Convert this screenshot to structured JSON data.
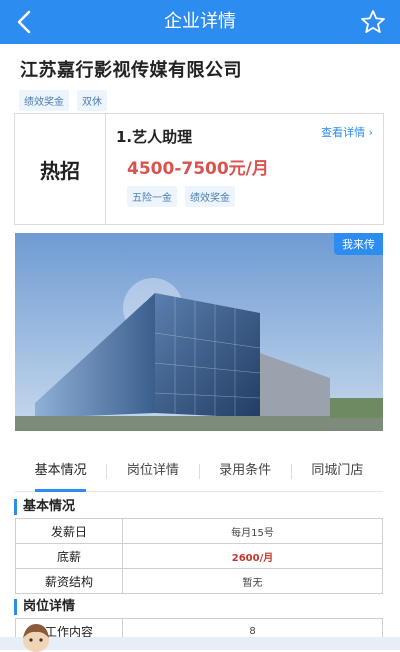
{
  "header": {
    "title": "企业详情",
    "back_icon": "chevron-left-icon",
    "fav_icon": "star-icon",
    "color": "#2d8cf0"
  },
  "company": {
    "name": "江苏嘉行影视传媒有限公司",
    "tags": [
      "绩效奖金",
      "双休"
    ]
  },
  "hot_job": {
    "badge": "热招",
    "title": "1.艺人助理",
    "salary": "4500-7500元/月",
    "view_detail": "查看详情 ›",
    "tags": [
      "五险一金",
      "绩效奖金"
    ]
  },
  "banner": {
    "badge": "我来传"
  },
  "tabs": [
    "基本情况",
    "岗位详情",
    "录用条件",
    "同城门店"
  ],
  "basic": {
    "title": "基本情况",
    "rows": [
      {
        "k": "发薪日",
        "v": "每月15号"
      },
      {
        "k": "底薪",
        "v": "2600/月"
      },
      {
        "k": "薪资结构",
        "v": "暂无"
      }
    ]
  },
  "job_detail": {
    "title": "岗位详情",
    "rows": [
      {
        "k": "工作内容",
        "v": "8"
      }
    ]
  }
}
